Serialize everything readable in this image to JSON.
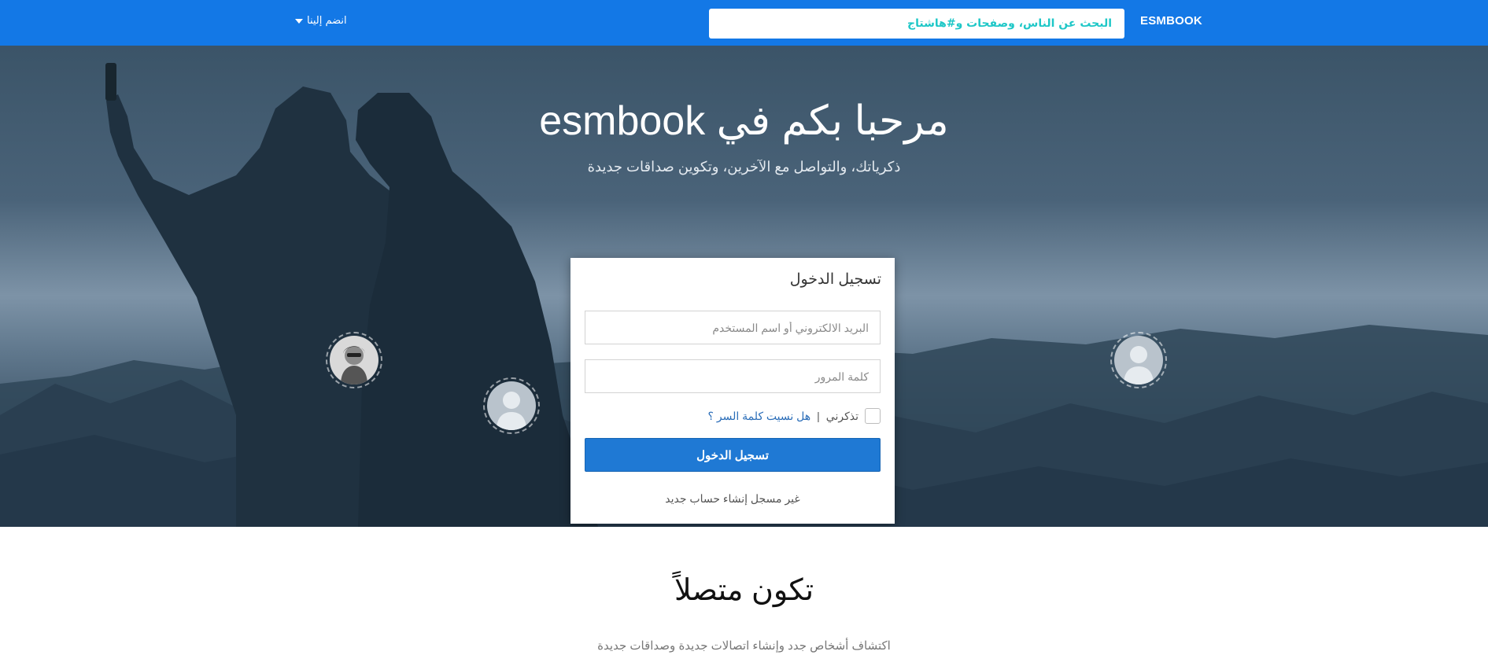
{
  "nav": {
    "brand": "ESMBOOK",
    "search_placeholder": "البحث عن الناس، وصفحات و#هاشتاج",
    "join_label": "انضم إلينا"
  },
  "hero": {
    "title": "مرحبا بكم في esmbook",
    "subtitle": "ذكرياتك، والتواصل مع الآخرين، وتكوين صداقات جديدة"
  },
  "login": {
    "title": "تسجيل الدخول",
    "email_placeholder": "البريد الالكتروني أو اسم المستخدم",
    "password_placeholder": "كلمة المرور",
    "remember_label": "تذكرني",
    "separator": "|",
    "forgot_label": "هل نسيت كلمة السر ؟",
    "submit_label": "تسجيل الدخول",
    "register_prefix": "غير مسجل",
    "register_link": "إنشاء حساب جديد"
  },
  "section": {
    "title": "تكون متصلاً",
    "subtitle": "اكتشاف أشخاص جدد وإنشاء اتصالات جديدة وصداقات جديدة"
  },
  "colors": {
    "primary": "#1378e6",
    "button": "#1f79d4",
    "search_placeholder": "#1ec7c7"
  }
}
